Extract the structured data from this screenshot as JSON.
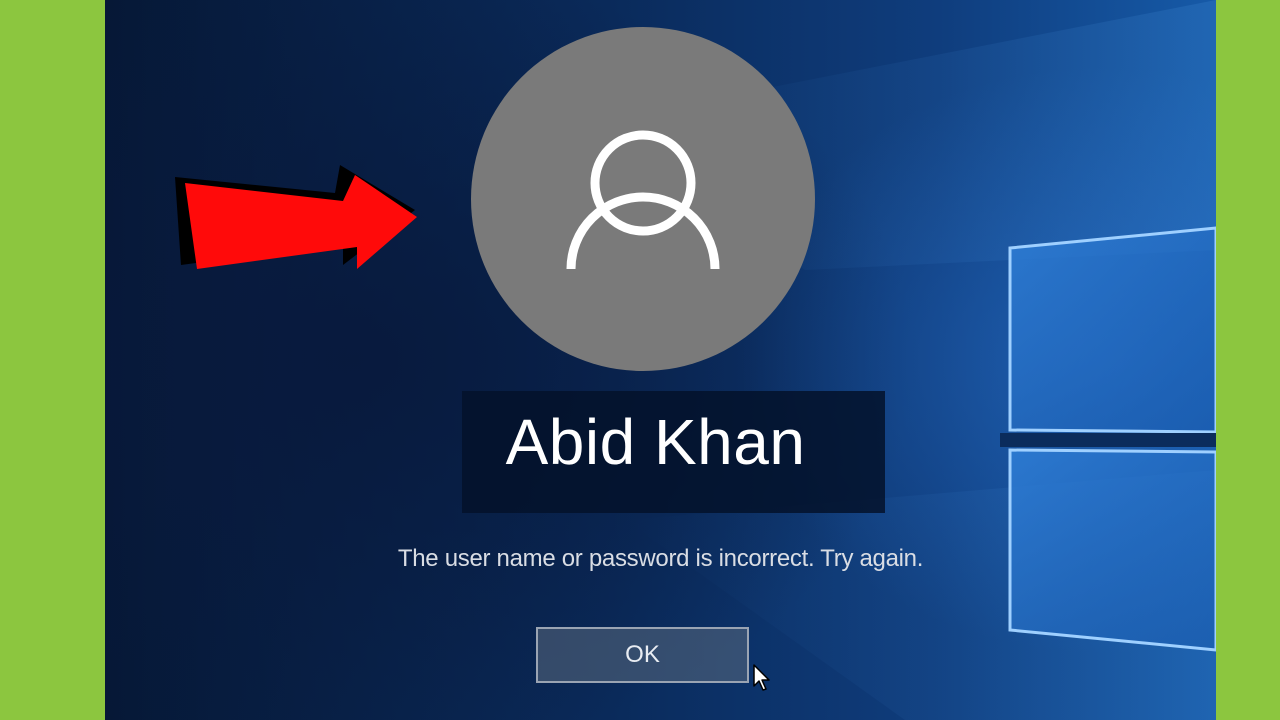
{
  "user": {
    "name": "Abid Khan"
  },
  "error": {
    "message": "The user name or password is incorrect. Try again."
  },
  "dialog": {
    "ok_label": "OK"
  },
  "icons": {
    "avatar": "user-avatar-icon",
    "pointer": "mouse-pointer-icon",
    "annotation": "red-arrow-icon"
  },
  "colors": {
    "frame": "#8cc63f",
    "background": "#0a2a5a",
    "avatar": "#7a7a7a",
    "arrow": "#ff0a0a"
  }
}
